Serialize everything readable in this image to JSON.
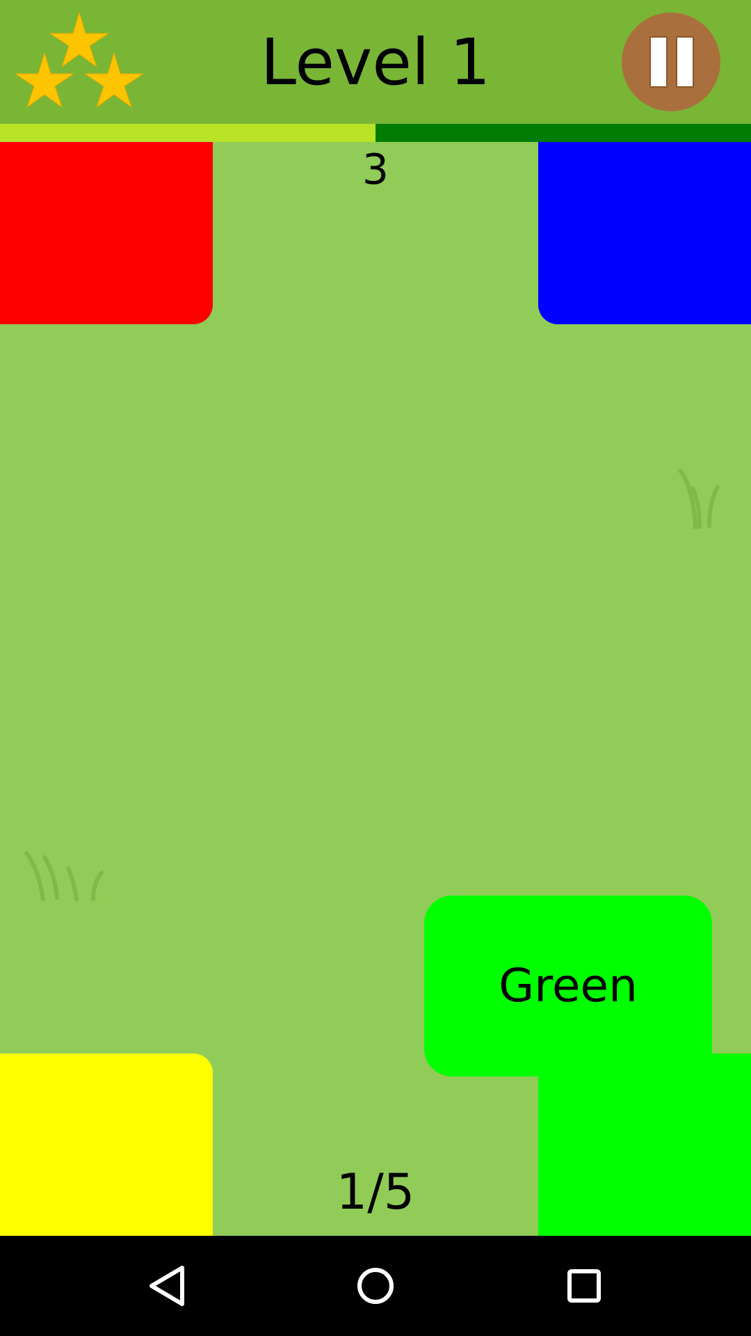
{
  "header": {
    "title": "Level 1",
    "stars_earned": 3,
    "stars_total": 3,
    "stars_icon": "star-icon",
    "pause_icon": "pause-icon",
    "star_color": "#ffc400",
    "pause_color": "#a9703d"
  },
  "progress": {
    "fraction": 0.5,
    "fill_color": "#b8e326",
    "track_color": "#037c03"
  },
  "game": {
    "counter": "3",
    "card_label": "Green",
    "page_indicator": "1/5",
    "blocks": {
      "red": "#ff0000",
      "blue": "#0000ff",
      "yellow": "#ffff00",
      "green": "#00ff00"
    },
    "background_color": "#91cc58"
  },
  "navbar": {
    "back_icon": "back-triangle-icon",
    "home_icon": "home-circle-icon",
    "recent_icon": "recent-apps-square-icon"
  }
}
